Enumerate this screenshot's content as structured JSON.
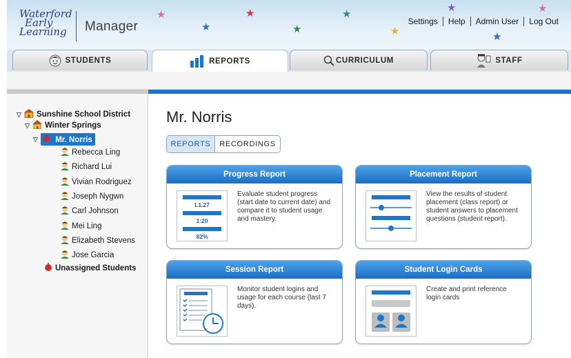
{
  "header": {
    "logo": {
      "line1": "Waterford",
      "line2": "Early",
      "line3": "Learning"
    },
    "app_title": "Manager",
    "links": [
      "Settings",
      "Help",
      "Admin User",
      "Log Out"
    ]
  },
  "tabs": [
    {
      "label": "STUDENTS",
      "icon": "student-face-icon",
      "active": false
    },
    {
      "label": "REPORTS",
      "icon": "bar-chart-icon",
      "active": true
    },
    {
      "label": "CURRICULUM",
      "icon": "magnifier-icon",
      "active": false
    },
    {
      "label": "STAFF",
      "icon": "staff-icon",
      "active": false
    }
  ],
  "tree": {
    "district": "Sunshine School District",
    "school": "Winter Springs",
    "teacher": "Mr. Norris",
    "students": [
      "Rebecca Ling",
      "Richard Lui",
      "Vivian Rodriguez",
      "Joseph Nygwn",
      "Carl Johnson",
      "Mei Ling",
      "Elizabeth Stevens",
      "Jose Garcia"
    ],
    "unassigned": "Unassigned Students"
  },
  "main": {
    "title": "Mr. Norris",
    "toggle": {
      "reports": "REPORTS",
      "recordings": "RECORDINGS"
    },
    "cards": [
      {
        "title": "Progress Report",
        "description": "Evaluate student progress (start date to current date) and compare it to student usage and mastery.",
        "thumb_values": [
          "L1.27",
          "1:20",
          "82%"
        ]
      },
      {
        "title": "Placement Report",
        "description": "View the results of student placement (class report) or student answers to placement questions (student report)."
      },
      {
        "title": "Session Report",
        "description": "Monitor student logins and usage for each course (last 7 days)."
      },
      {
        "title": "Student Login Cards",
        "description": "Create and print reference login cards"
      }
    ]
  },
  "colors": {
    "accent": "#1c76c9",
    "header_bg": "#d4e6f4",
    "selected": "#1c76c9"
  }
}
